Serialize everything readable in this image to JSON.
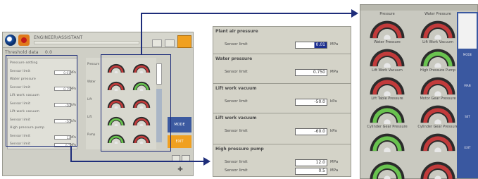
{
  "main_screen": {
    "title": "ENGINEER/ASSISTANT",
    "subtitle": "Threshold data",
    "subtitle_value": "0.0",
    "left_panel": {
      "rows": [
        {
          "label": "Pressure setting",
          "value": ""
        },
        {
          "label": "Sensor limit",
          "value": "0.01",
          "unit": "MPa"
        },
        {
          "label": "Water pressure",
          "value": ""
        },
        {
          "label": "Sensor limit",
          "value": "0.75",
          "unit": "MPa"
        },
        {
          "label": "Lift work vacuum",
          "value": ""
        },
        {
          "label": "Sensor limit",
          "value": "-50",
          "unit": "kPa"
        },
        {
          "label": "Lift work vacuum",
          "value": ""
        },
        {
          "label": "Sensor limit",
          "value": "-50",
          "unit": "kPa"
        },
        {
          "label": "High pressure pump",
          "value": ""
        },
        {
          "label": "Sensor limit",
          "value": "12",
          "unit": "MPa"
        },
        {
          "label": "Sensor limit",
          "value": "0.5",
          "unit": "MPa"
        }
      ]
    },
    "mini_labels": [
      "Pressure",
      "Water",
      "Lift",
      "Lift",
      "Pump"
    ],
    "buttons": {
      "blue": "MODE",
      "orange": "EXIT",
      "sq1": "",
      "sq2": ""
    },
    "nav_glyph": "✚"
  },
  "pressure_panel": {
    "sections": [
      {
        "heading": "Plant air pressure",
        "rows": [
          {
            "label": "Sensor limit",
            "value": "0.01",
            "unit": "MPa",
            "selected": true
          }
        ]
      },
      {
        "heading": "Water pressure",
        "rows": [
          {
            "label": "Sensor limit",
            "value": "0.750",
            "unit": "MPa",
            "selected": false
          }
        ]
      },
      {
        "heading": "Lift work vacuum",
        "rows": [
          {
            "label": "Sensor limit",
            "value": "-50.0",
            "unit": "kPa",
            "selected": false
          }
        ]
      },
      {
        "heading": "Lift work vacuum",
        "rows": [
          {
            "label": "Sensor limit",
            "value": "-60.0",
            "unit": "kPa",
            "selected": false
          }
        ]
      },
      {
        "heading": "High pressure pump",
        "rows": [
          {
            "label": "Sensor limit",
            "value": "12.0",
            "unit": "MPa",
            "selected": false
          },
          {
            "label": "Sensor limit",
            "value": "0.5",
            "unit": "MPa",
            "selected": false
          }
        ]
      }
    ]
  },
  "gauge_panel": {
    "gauges": [
      {
        "label": "Pressure",
        "state": "red"
      },
      {
        "label": "Water Pressure",
        "state": "red"
      },
      {
        "label": "Water Pressure",
        "state": "red"
      },
      {
        "label": "Lift Work Vacuum",
        "state": "green"
      },
      {
        "label": "Lift Work Vacuum",
        "state": "red"
      },
      {
        "label": "High Pressure Pump",
        "state": "red"
      },
      {
        "label": "Lift Table Pressure",
        "state": "green"
      },
      {
        "label": "Motor Gear Pressure",
        "state": "red"
      },
      {
        "label": "Cylinder Gear Pressure",
        "state": "green"
      },
      {
        "label": "Cylinder Gear Pressure",
        "state": "red"
      },
      {
        "label": "",
        "state": "green"
      },
      {
        "label": "",
        "state": "red"
      }
    ],
    "side_labels": [
      "MODE",
      "MAN",
      "SET",
      "EXIT"
    ]
  },
  "colors": {
    "accent_blue": "#1e2d7a",
    "gauge_red": "#c23b3b",
    "gauge_green": "#69c34f",
    "orange": "#f0a020"
  }
}
